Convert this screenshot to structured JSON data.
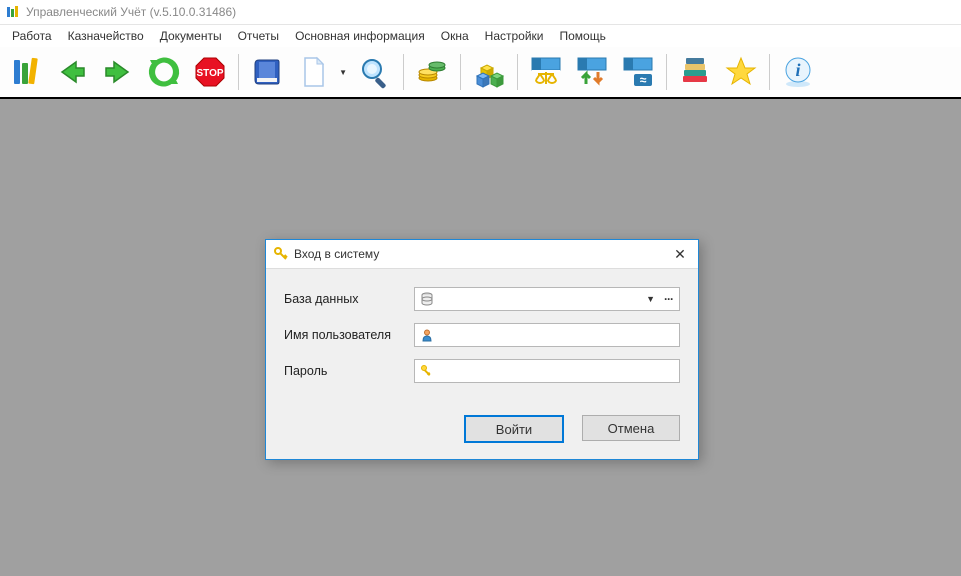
{
  "window": {
    "title": "Управленческий Учёт (v.5.10.0.31486)"
  },
  "menu": {
    "items": [
      "Работа",
      "Казначейство",
      "Документы",
      "Отчеты",
      "Основная информация",
      "Окна",
      "Настройки",
      "Помощь"
    ]
  },
  "toolbar": {
    "buttons": [
      {
        "name": "app-books-icon"
      },
      {
        "name": "nav-back-icon"
      },
      {
        "name": "nav-forward-icon"
      },
      {
        "name": "refresh-icon"
      },
      {
        "name": "stop-icon"
      },
      {
        "name": "sep"
      },
      {
        "name": "book-icon"
      },
      {
        "name": "new-doc-icon",
        "dropdown": true
      },
      {
        "name": "search-icon"
      },
      {
        "name": "sep"
      },
      {
        "name": "coins-icon"
      },
      {
        "name": "sep"
      },
      {
        "name": "cubes-icon"
      },
      {
        "name": "sep"
      },
      {
        "name": "grid-scales-icon"
      },
      {
        "name": "grid-transfer-icon"
      },
      {
        "name": "grid-approx-icon"
      },
      {
        "name": "sep"
      },
      {
        "name": "books-colored-icon"
      },
      {
        "name": "favorite-icon"
      },
      {
        "name": "sep"
      },
      {
        "name": "info-icon"
      }
    ]
  },
  "dialog": {
    "title": "Вход в систему",
    "labels": {
      "database": "База данных",
      "username": "Имя пользователя",
      "password": "Пароль"
    },
    "values": {
      "database": "",
      "username": "",
      "password": ""
    },
    "buttons": {
      "login": "Войти",
      "cancel": "Отмена"
    }
  }
}
